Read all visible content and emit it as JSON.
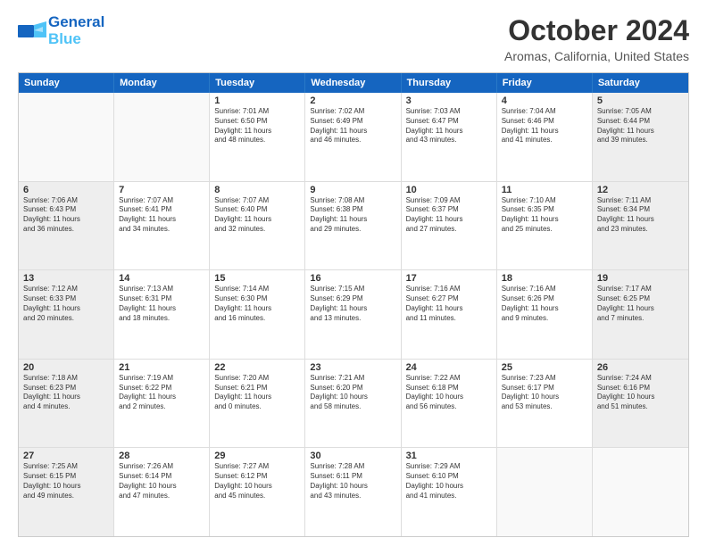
{
  "logo": {
    "line1": "General",
    "line2": "Blue"
  },
  "title": "October 2024",
  "location": "Aromas, California, United States",
  "days_of_week": [
    "Sunday",
    "Monday",
    "Tuesday",
    "Wednesday",
    "Thursday",
    "Friday",
    "Saturday"
  ],
  "weeks": [
    [
      {
        "day": "",
        "lines": [],
        "empty": true
      },
      {
        "day": "",
        "lines": [],
        "empty": true
      },
      {
        "day": "1",
        "lines": [
          "Sunrise: 7:01 AM",
          "Sunset: 6:50 PM",
          "Daylight: 11 hours",
          "and 48 minutes."
        ],
        "shaded": false
      },
      {
        "day": "2",
        "lines": [
          "Sunrise: 7:02 AM",
          "Sunset: 6:49 PM",
          "Daylight: 11 hours",
          "and 46 minutes."
        ],
        "shaded": false
      },
      {
        "day": "3",
        "lines": [
          "Sunrise: 7:03 AM",
          "Sunset: 6:47 PM",
          "Daylight: 11 hours",
          "and 43 minutes."
        ],
        "shaded": false
      },
      {
        "day": "4",
        "lines": [
          "Sunrise: 7:04 AM",
          "Sunset: 6:46 PM",
          "Daylight: 11 hours",
          "and 41 minutes."
        ],
        "shaded": false
      },
      {
        "day": "5",
        "lines": [
          "Sunrise: 7:05 AM",
          "Sunset: 6:44 PM",
          "Daylight: 11 hours",
          "and 39 minutes."
        ],
        "shaded": true
      }
    ],
    [
      {
        "day": "6",
        "lines": [
          "Sunrise: 7:06 AM",
          "Sunset: 6:43 PM",
          "Daylight: 11 hours",
          "and 36 minutes."
        ],
        "shaded": true
      },
      {
        "day": "7",
        "lines": [
          "Sunrise: 7:07 AM",
          "Sunset: 6:41 PM",
          "Daylight: 11 hours",
          "and 34 minutes."
        ],
        "shaded": false
      },
      {
        "day": "8",
        "lines": [
          "Sunrise: 7:07 AM",
          "Sunset: 6:40 PM",
          "Daylight: 11 hours",
          "and 32 minutes."
        ],
        "shaded": false
      },
      {
        "day": "9",
        "lines": [
          "Sunrise: 7:08 AM",
          "Sunset: 6:38 PM",
          "Daylight: 11 hours",
          "and 29 minutes."
        ],
        "shaded": false
      },
      {
        "day": "10",
        "lines": [
          "Sunrise: 7:09 AM",
          "Sunset: 6:37 PM",
          "Daylight: 11 hours",
          "and 27 minutes."
        ],
        "shaded": false
      },
      {
        "day": "11",
        "lines": [
          "Sunrise: 7:10 AM",
          "Sunset: 6:35 PM",
          "Daylight: 11 hours",
          "and 25 minutes."
        ],
        "shaded": false
      },
      {
        "day": "12",
        "lines": [
          "Sunrise: 7:11 AM",
          "Sunset: 6:34 PM",
          "Daylight: 11 hours",
          "and 23 minutes."
        ],
        "shaded": true
      }
    ],
    [
      {
        "day": "13",
        "lines": [
          "Sunrise: 7:12 AM",
          "Sunset: 6:33 PM",
          "Daylight: 11 hours",
          "and 20 minutes."
        ],
        "shaded": true
      },
      {
        "day": "14",
        "lines": [
          "Sunrise: 7:13 AM",
          "Sunset: 6:31 PM",
          "Daylight: 11 hours",
          "and 18 minutes."
        ],
        "shaded": false
      },
      {
        "day": "15",
        "lines": [
          "Sunrise: 7:14 AM",
          "Sunset: 6:30 PM",
          "Daylight: 11 hours",
          "and 16 minutes."
        ],
        "shaded": false
      },
      {
        "day": "16",
        "lines": [
          "Sunrise: 7:15 AM",
          "Sunset: 6:29 PM",
          "Daylight: 11 hours",
          "and 13 minutes."
        ],
        "shaded": false
      },
      {
        "day": "17",
        "lines": [
          "Sunrise: 7:16 AM",
          "Sunset: 6:27 PM",
          "Daylight: 11 hours",
          "and 11 minutes."
        ],
        "shaded": false
      },
      {
        "day": "18",
        "lines": [
          "Sunrise: 7:16 AM",
          "Sunset: 6:26 PM",
          "Daylight: 11 hours",
          "and 9 minutes."
        ],
        "shaded": false
      },
      {
        "day": "19",
        "lines": [
          "Sunrise: 7:17 AM",
          "Sunset: 6:25 PM",
          "Daylight: 11 hours",
          "and 7 minutes."
        ],
        "shaded": true
      }
    ],
    [
      {
        "day": "20",
        "lines": [
          "Sunrise: 7:18 AM",
          "Sunset: 6:23 PM",
          "Daylight: 11 hours",
          "and 4 minutes."
        ],
        "shaded": true
      },
      {
        "day": "21",
        "lines": [
          "Sunrise: 7:19 AM",
          "Sunset: 6:22 PM",
          "Daylight: 11 hours",
          "and 2 minutes."
        ],
        "shaded": false
      },
      {
        "day": "22",
        "lines": [
          "Sunrise: 7:20 AM",
          "Sunset: 6:21 PM",
          "Daylight: 11 hours",
          "and 0 minutes."
        ],
        "shaded": false
      },
      {
        "day": "23",
        "lines": [
          "Sunrise: 7:21 AM",
          "Sunset: 6:20 PM",
          "Daylight: 10 hours",
          "and 58 minutes."
        ],
        "shaded": false
      },
      {
        "day": "24",
        "lines": [
          "Sunrise: 7:22 AM",
          "Sunset: 6:18 PM",
          "Daylight: 10 hours",
          "and 56 minutes."
        ],
        "shaded": false
      },
      {
        "day": "25",
        "lines": [
          "Sunrise: 7:23 AM",
          "Sunset: 6:17 PM",
          "Daylight: 10 hours",
          "and 53 minutes."
        ],
        "shaded": false
      },
      {
        "day": "26",
        "lines": [
          "Sunrise: 7:24 AM",
          "Sunset: 6:16 PM",
          "Daylight: 10 hours",
          "and 51 minutes."
        ],
        "shaded": true
      }
    ],
    [
      {
        "day": "27",
        "lines": [
          "Sunrise: 7:25 AM",
          "Sunset: 6:15 PM",
          "Daylight: 10 hours",
          "and 49 minutes."
        ],
        "shaded": true
      },
      {
        "day": "28",
        "lines": [
          "Sunrise: 7:26 AM",
          "Sunset: 6:14 PM",
          "Daylight: 10 hours",
          "and 47 minutes."
        ],
        "shaded": false
      },
      {
        "day": "29",
        "lines": [
          "Sunrise: 7:27 AM",
          "Sunset: 6:12 PM",
          "Daylight: 10 hours",
          "and 45 minutes."
        ],
        "shaded": false
      },
      {
        "day": "30",
        "lines": [
          "Sunrise: 7:28 AM",
          "Sunset: 6:11 PM",
          "Daylight: 10 hours",
          "and 43 minutes."
        ],
        "shaded": false
      },
      {
        "day": "31",
        "lines": [
          "Sunrise: 7:29 AM",
          "Sunset: 6:10 PM",
          "Daylight: 10 hours",
          "and 41 minutes."
        ],
        "shaded": false
      },
      {
        "day": "",
        "lines": [],
        "empty": true
      },
      {
        "day": "",
        "lines": [],
        "empty": true
      }
    ]
  ]
}
